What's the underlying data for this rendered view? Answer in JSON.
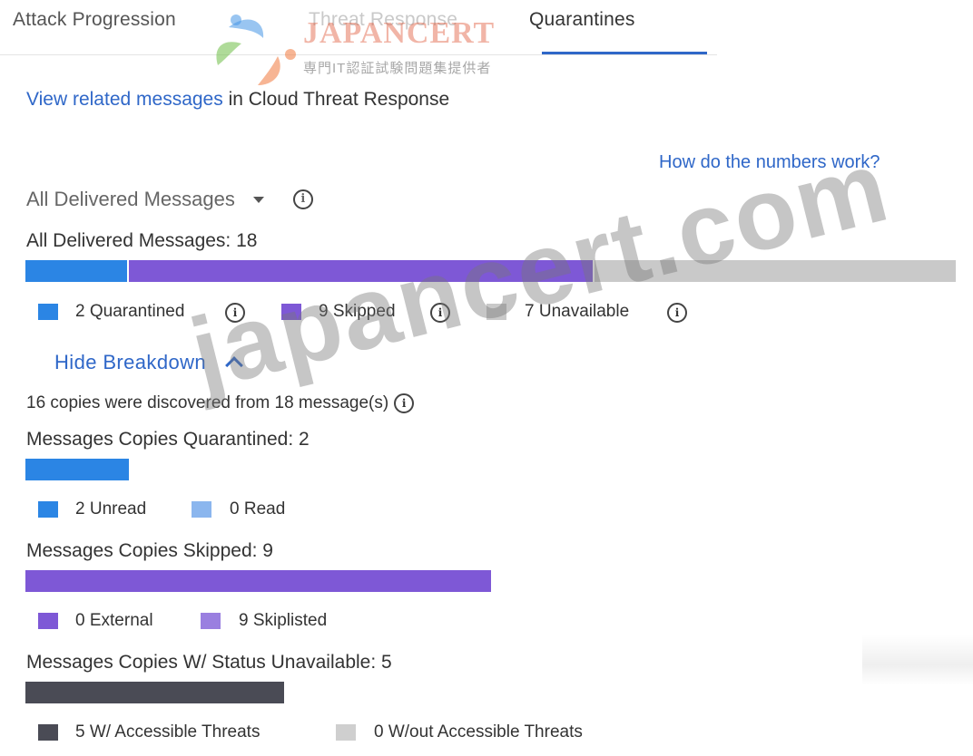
{
  "tabs": [
    {
      "label": "Attack Progression",
      "state": "partial"
    },
    {
      "label": "Threat Response",
      "state": "faded"
    },
    {
      "label": "Quarantines",
      "state": "active"
    }
  ],
  "watermark": {
    "logo_text": "JAPANCERT",
    "logo_subtitle": "専門IT認証試験問題集提供者",
    "overlay_text": "japancert.com"
  },
  "related": {
    "link": "View related messages",
    "rest": " in Cloud Threat Response"
  },
  "help_link": "How do the numbers work?",
  "selector": {
    "label": "All Delivered Messages"
  },
  "summary": {
    "title": "All Delivered Messages: 18",
    "total": 18,
    "segments": [
      {
        "label": "2 Quarantined",
        "value": 2,
        "color": "#2b85e4"
      },
      {
        "label": "9 Skipped",
        "value": 9,
        "color": "#7e58d6"
      },
      {
        "label": "7 Unavailable",
        "value": 7,
        "color": "#c9c9c9"
      }
    ]
  },
  "breakdown": {
    "toggle": "Hide Breakdown",
    "note": "16 copies were discovered from 18 message(s)",
    "quarantined": {
      "title": "Messages Copies Quarantined: 2",
      "value": 2,
      "color": "#2b85e4",
      "legend": [
        {
          "label": "2 Unread",
          "color": "#2b85e4"
        },
        {
          "label": "0 Read",
          "color": "#8bb6ee"
        }
      ]
    },
    "skipped": {
      "title": "Messages Copies Skipped: 9",
      "value": 9,
      "color": "#7e58d6",
      "legend": [
        {
          "label": "0 External",
          "color": "#7e58d6"
        },
        {
          "label": "9 Skiplisted",
          "color": "#9a7fe0"
        }
      ]
    },
    "unavailable": {
      "title": "Messages Copies W/ Status Unavailable: 5",
      "value": 5,
      "color": "#4a4b55",
      "legend": [
        {
          "label": "5 W/ Accessible Threats",
          "color": "#4a4b55"
        },
        {
          "label": "0 W/out Accessible Threats",
          "color": "#cfcfcf"
        }
      ]
    }
  }
}
